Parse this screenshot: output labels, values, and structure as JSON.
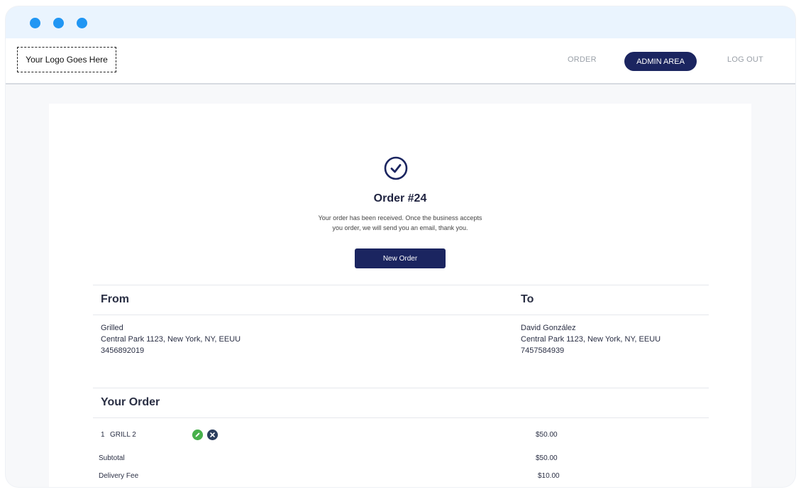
{
  "navbar": {
    "logo_text": "Your Logo Goes Here",
    "links": {
      "order": "ORDER",
      "admin": "ADMIN AREA",
      "logout": "LOG OUT"
    }
  },
  "confirmation": {
    "title": "Order #24",
    "message_line1": "Your order has been received. Once the business accepts",
    "message_line2": "you order, we will send you an email, thank you.",
    "button_label": "New Order"
  },
  "from": {
    "heading": "From",
    "name": "Grilled",
    "address": "Central Park 1123, New York, NY, EEUU",
    "phone": "3456892019"
  },
  "to": {
    "heading": "To",
    "name": "David González",
    "address": "Central Park 1123, New York, NY, EEUU",
    "phone": "7457584939"
  },
  "your_order": {
    "heading": "Your Order",
    "items": [
      {
        "qty": "1",
        "name": "GRILL 2",
        "price": "$50.00"
      }
    ],
    "subtotal_label": "Subtotal",
    "subtotal_value": "$50.00",
    "delivery_label": "Delivery Fee",
    "delivery_value": "$10.00"
  },
  "colors": {
    "accent": "#1b2560",
    "traffic_dot": "#2196f3",
    "edit": "#47b04b",
    "remove": "#2b3e5e"
  },
  "icons": {
    "success": "check-circle-icon",
    "edit": "pencil-icon",
    "remove": "close-icon"
  }
}
